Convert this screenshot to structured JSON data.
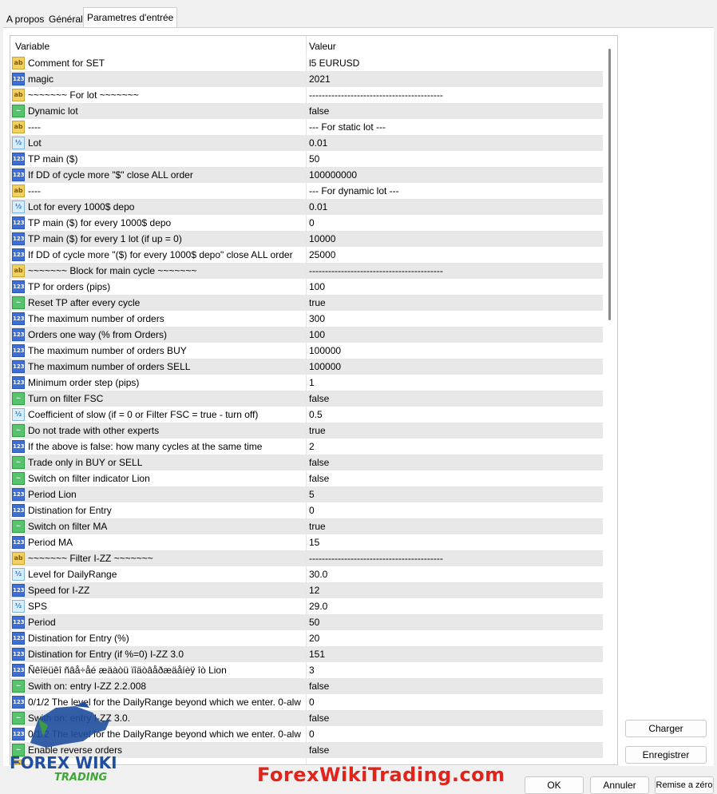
{
  "tabs": [
    "A propos",
    "Général",
    "Parametres d'entrée"
  ],
  "grid": {
    "headers": {
      "variable": "Variable",
      "value": "Valeur"
    },
    "rows": [
      {
        "icon": "ab",
        "name": "Comment for SET",
        "value": "l5 EURUSD"
      },
      {
        "icon": "123",
        "name": "magic",
        "value": "2021"
      },
      {
        "icon": "ab",
        "name": "~~~~~~~   For lot   ~~~~~~~",
        "value": "------------------------------------------"
      },
      {
        "icon": "bool",
        "name": "Dynamic lot",
        "value": "false"
      },
      {
        "icon": "ab",
        "name": "----",
        "value": "--- For static lot ---"
      },
      {
        "icon": "v12",
        "name": "Lot",
        "value": "0.01"
      },
      {
        "icon": "123",
        "name": "TP main ($)",
        "value": "50"
      },
      {
        "icon": "123",
        "name": "If DD of cycle more \"$\" close ALL order",
        "value": "100000000"
      },
      {
        "icon": "ab",
        "name": "----",
        "value": "--- For dynamic lot ---"
      },
      {
        "icon": "v12",
        "name": "Lot for every 1000$ depo",
        "value": "0.01"
      },
      {
        "icon": "123",
        "name": "TP main ($) for every 1000$ depo",
        "value": "0"
      },
      {
        "icon": "123",
        "name": "TP main ($) for every 1 lot (if up = 0)",
        "value": "10000"
      },
      {
        "icon": "123",
        "name": "If DD of cycle more \"($) for every 1000$ depo\" close ALL order",
        "value": "25000"
      },
      {
        "icon": "ab",
        "name": "~~~~~~~  Block for main cycle  ~~~~~~~",
        "value": "------------------------------------------"
      },
      {
        "icon": "123",
        "name": "TP for orders (pips)",
        "value": "100"
      },
      {
        "icon": "bool",
        "name": "Reset TP after every cycle",
        "value": "true"
      },
      {
        "icon": "123",
        "name": "The maximum number of orders",
        "value": "300"
      },
      {
        "icon": "123",
        "name": "Orders one way (% from Orders)",
        "value": "100"
      },
      {
        "icon": "123",
        "name": "The maximum number of orders BUY",
        "value": "100000"
      },
      {
        "icon": "123",
        "name": "The maximum number of orders SELL",
        "value": "100000"
      },
      {
        "icon": "123",
        "name": "Minimum order step (pips)",
        "value": "1"
      },
      {
        "icon": "bool",
        "name": "Turn on filter FSC",
        "value": "false"
      },
      {
        "icon": "v12",
        "name": "Coefficient of slow (if = 0 or Filter FSC = true - turn off)",
        "value": "0.5"
      },
      {
        "icon": "bool",
        "name": "Do not trade with other experts",
        "value": "true"
      },
      {
        "icon": "123",
        "name": "If the above is false: how many cycles at the same time",
        "value": "2"
      },
      {
        "icon": "bool",
        "name": "Trade only in BUY or SELL",
        "value": "false"
      },
      {
        "icon": "bool",
        "name": "Switch on filter indicator Lion",
        "value": "false"
      },
      {
        "icon": "123",
        "name": "Period Lion",
        "value": "5"
      },
      {
        "icon": "123",
        "name": "Distination for Entry",
        "value": "0"
      },
      {
        "icon": "bool",
        "name": "Switch on filter MA",
        "value": "true"
      },
      {
        "icon": "123",
        "name": "Period MA",
        "value": "15"
      },
      {
        "icon": "ab",
        "name": "~~~~~~~   Filter I-ZZ   ~~~~~~~",
        "value": "------------------------------------------"
      },
      {
        "icon": "v12",
        "name": "Level for DailyRange",
        "value": "30.0"
      },
      {
        "icon": "123",
        "name": "Speed for I-ZZ",
        "value": "12"
      },
      {
        "icon": "v12",
        "name": "SPS",
        "value": "29.0"
      },
      {
        "icon": "123",
        "name": "Period",
        "value": "50"
      },
      {
        "icon": "123",
        "name": "Distination for Entry (%)",
        "value": "20"
      },
      {
        "icon": "123",
        "name": "Distination for Entry (if %=0) I-ZZ 3.0",
        "value": "151"
      },
      {
        "icon": "123",
        "name": "Ñêîëüêî ñâå÷åé æäàòü ïîäòâåðæäåíèÿ îò Lion",
        "value": "3"
      },
      {
        "icon": "bool",
        "name": "Swith on: entry I-ZZ 2.2.008",
        "value": "false"
      },
      {
        "icon": "123",
        "name": "0/1/2 The level for the DailyRange beyond which we enter. 0-alw",
        "value": "0"
      },
      {
        "icon": "bool",
        "name": "Swith on: entry I-ZZ 3.0.",
        "value": "false"
      },
      {
        "icon": "123",
        "name": "0/1/2 The level for the DailyRange beyond which we enter. 0-alw",
        "value": "0"
      },
      {
        "icon": "bool",
        "name": "Enable reverse orders",
        "value": "false"
      },
      {
        "icon": "ab",
        "name": "~~~~~~~",
        "value": ""
      }
    ]
  },
  "icon_labels": {
    "ab": "ab",
    "123": "123",
    "v12": "½",
    "bool": "~"
  },
  "buttons": {
    "charger": "Charger",
    "enregistrer": "Enregistrer",
    "ok": "OK",
    "annuler": "Annuler",
    "remise": "Remise a zéro"
  },
  "logo": {
    "line1": "FOREX WIKI",
    "line2": "TRADING"
  },
  "watermark": "ForexWikiTrading.com",
  "colors": {
    "watermark": "#e2231a",
    "logo_blue": "#1f4f9e",
    "logo_green": "#3fa535"
  }
}
